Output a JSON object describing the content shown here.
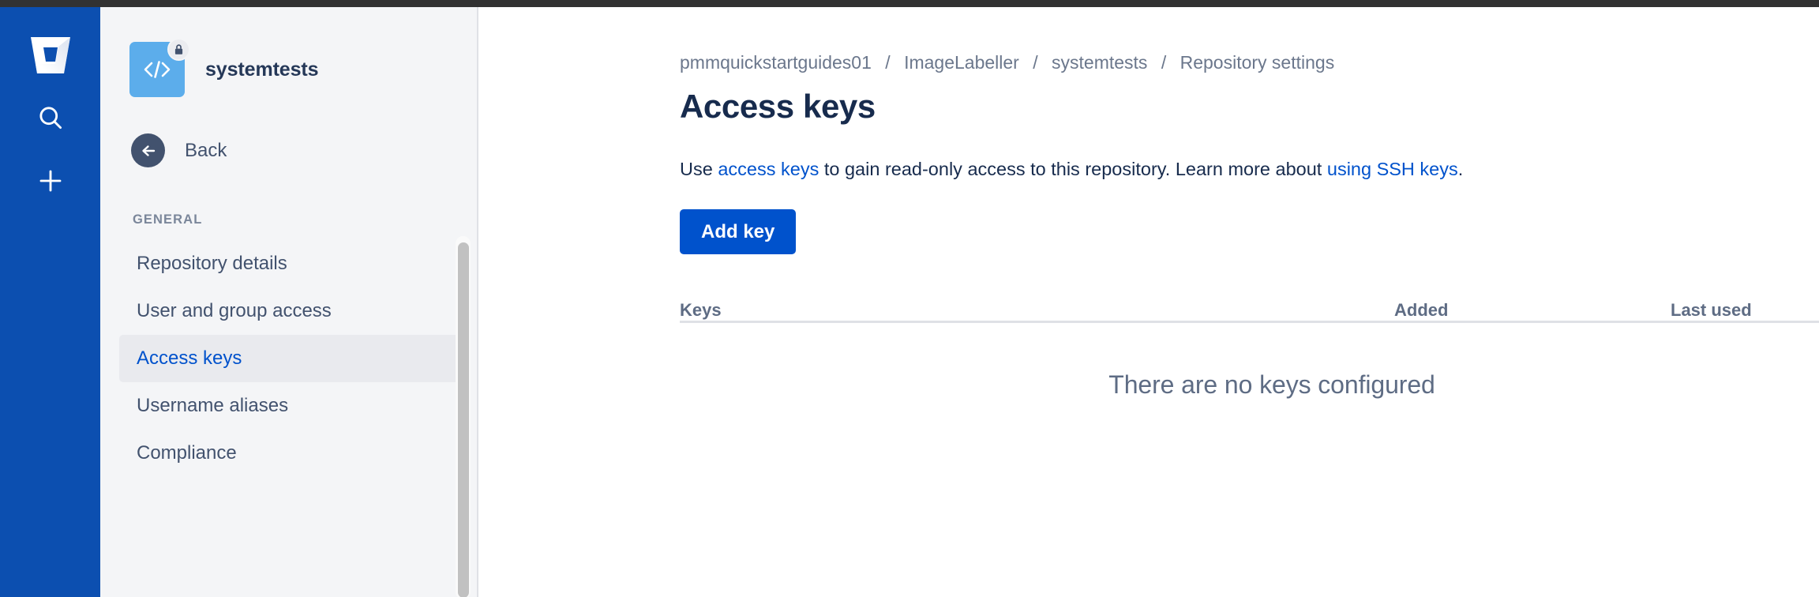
{
  "window": {
    "chrome_color": "#323232"
  },
  "rail": {
    "brand_color": "#0c4fb0",
    "items": [
      {
        "name": "bitbucket-logo",
        "label": "Bitbucket"
      },
      {
        "name": "search-icon",
        "label": "Search"
      },
      {
        "name": "create-icon",
        "label": "Create"
      }
    ]
  },
  "sidebar": {
    "repo": {
      "name": "systemtests",
      "avatar_glyph": "</>",
      "avatar_color": "#5cadeb",
      "badge": "lock-icon",
      "access": "private"
    },
    "back": {
      "label": "Back",
      "icon": "arrow-left-icon"
    },
    "section_label": "GENERAL",
    "items": [
      {
        "label": "Repository details",
        "selected": false
      },
      {
        "label": "User and group access",
        "selected": false
      },
      {
        "label": "Access keys",
        "selected": true
      },
      {
        "label": "Username aliases",
        "selected": false
      },
      {
        "label": "Compliance",
        "selected": false
      }
    ],
    "selected_item": "Access keys",
    "selected_color": "#0052cc",
    "selected_bg": "#e9eaee"
  },
  "main": {
    "breadcrumb": [
      "pmmquickstartguides01",
      "ImageLabeller",
      "systemtests",
      "Repository settings"
    ],
    "breadcrumb_separator": "/",
    "title": "Access keys",
    "description": {
      "prefix": "Use ",
      "link1": "access keys",
      "middle": " to gain read-only access to this repository. Learn more about ",
      "link2": "using SSH keys",
      "suffix": "."
    },
    "add_key_button": {
      "label": "Add key",
      "color": "#0052cc"
    },
    "table": {
      "columns": [
        "Keys",
        "Added",
        "Last used"
      ],
      "rows": [],
      "empty_message": "There are no keys configured"
    }
  }
}
